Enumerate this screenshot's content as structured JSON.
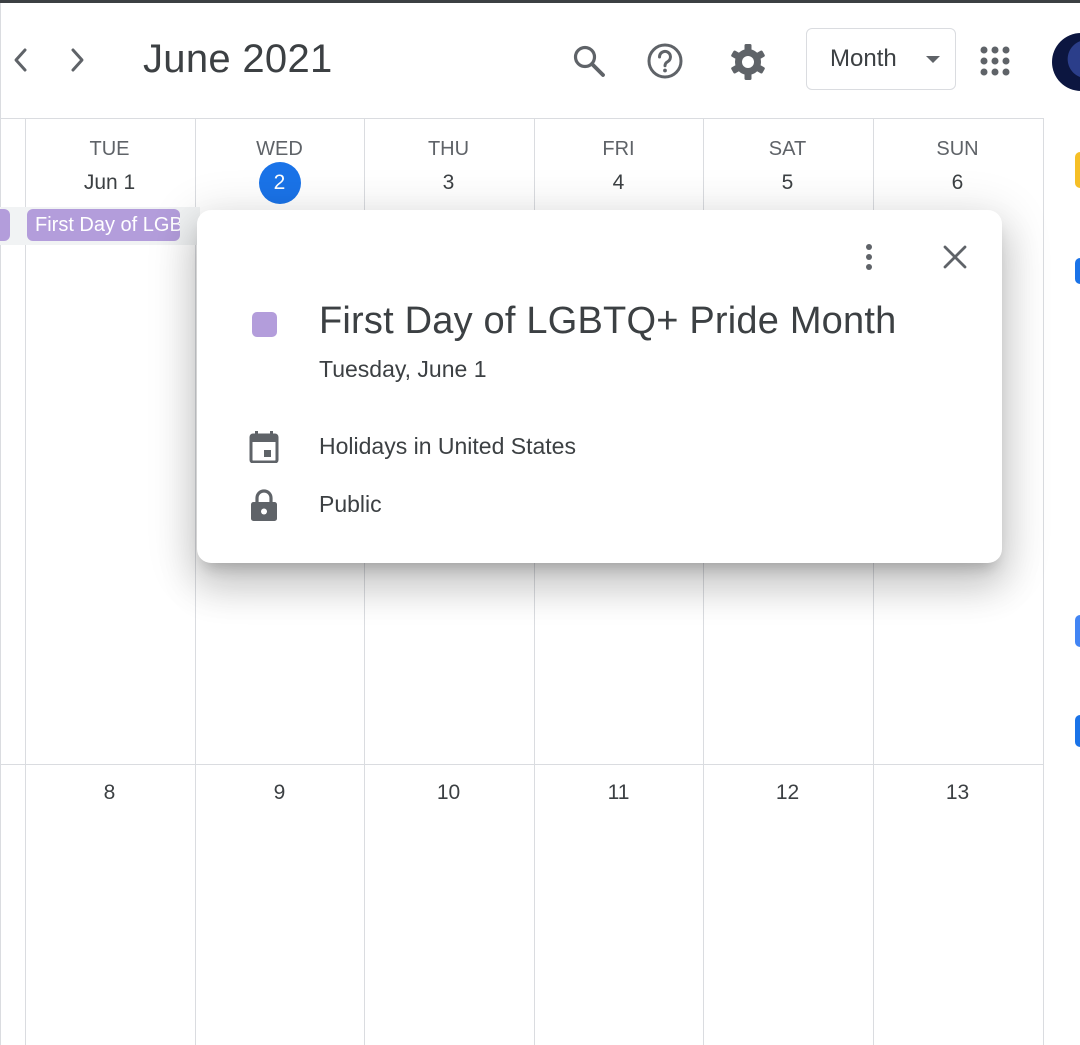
{
  "header": {
    "month_title": "June 2021",
    "view_selector": "Month"
  },
  "week1": [
    {
      "dow": "TUE",
      "date": "Jun 1"
    },
    {
      "dow": "WED",
      "date": "2",
      "today": true
    },
    {
      "dow": "THU",
      "date": "3"
    },
    {
      "dow": "FRI",
      "date": "4"
    },
    {
      "dow": "SAT",
      "date": "5"
    },
    {
      "dow": "SUN",
      "date": "6"
    }
  ],
  "week2": [
    "8",
    "9",
    "10",
    "11",
    "12",
    "13"
  ],
  "event_chip": {
    "label": "First Day of LGBTQ+ Pride Month"
  },
  "popup": {
    "title": "First Day of LGBTQ+ Pride Month",
    "date": "Tuesday, June 1",
    "calendar": "Holidays in United States",
    "visibility": "Public"
  },
  "colors": {
    "event": "#b39ddb",
    "today": "#1a73e8",
    "text": "#3c4043",
    "grid": "#dadce0"
  },
  "icons": [
    "chevron-left-icon",
    "chevron-right-icon",
    "search-icon",
    "help-icon",
    "settings-icon",
    "apps-grid-icon",
    "more-vert-icon",
    "close-icon",
    "calendar-icon",
    "lock-icon"
  ]
}
